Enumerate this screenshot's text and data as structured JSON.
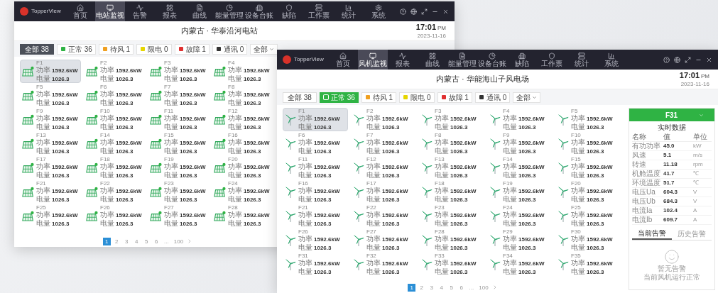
{
  "windows": [
    {
      "kind": "solar",
      "logo": "TopperView",
      "title": "内蒙古 · 华泰沿河电站",
      "clock": {
        "time": "17:01",
        "meridiem": "PM",
        "date": "2023-11-16"
      },
      "nav": [
        {
          "label": "首页",
          "selected": false
        },
        {
          "label": "电站监视",
          "selected": true
        },
        {
          "label": "告警",
          "selected": false
        },
        {
          "label": "报表",
          "selected": false
        },
        {
          "label": "曲线",
          "selected": false
        },
        {
          "label": "能量管理",
          "selected": false
        },
        {
          "label": "设备台账",
          "selected": false
        },
        {
          "label": "缺陷",
          "selected": false
        },
        {
          "label": "工作票",
          "selected": false
        },
        {
          "label": "统计",
          "selected": false
        },
        {
          "label": "系统",
          "selected": false
        }
      ],
      "filters": [
        {
          "kind": "total",
          "label": "全部",
          "count": "38",
          "selected": true
        },
        {
          "kind": "status",
          "label": "正常",
          "count": "36",
          "color": "#2fb344",
          "selected": false
        },
        {
          "kind": "status",
          "label": "待风",
          "count": "1",
          "color": "#f0a020",
          "selected": false
        },
        {
          "kind": "status",
          "label": "限电",
          "count": "0",
          "color": "#e6d600",
          "selected": false
        },
        {
          "kind": "status",
          "label": "故障",
          "count": "1",
          "color": "#e03030",
          "selected": false
        },
        {
          "kind": "status",
          "label": "通讯",
          "count": "0",
          "color": "#333333",
          "selected": false
        },
        {
          "kind": "dropdown",
          "label": "全部"
        }
      ],
      "cells": [
        {
          "name": "F1",
          "selected": true,
          "power_label": "功率",
          "power": "1592.6kW",
          "energy_label": "电量",
          "energy": "1026.3"
        },
        {
          "name": "F2",
          "selected": false,
          "power_label": "功率",
          "power": "1592.6kW",
          "energy_label": "电量",
          "energy": "1026.3"
        },
        {
          "name": "F3",
          "selected": false,
          "power_label": "功率",
          "power": "1592.6kW",
          "energy_label": "电量",
          "energy": "1026.3"
        },
        {
          "name": "F4",
          "selected": false,
          "power_label": "功率",
          "power": "1592.6kW",
          "energy_label": "电量",
          "energy": "1026.3"
        },
        {
          "name": "F5",
          "selected": false,
          "power_label": "功率",
          "power": "1592.6kW",
          "energy_label": "电量",
          "energy": "1026.3"
        },
        {
          "name": "F6",
          "selected": false,
          "power_label": "功率",
          "power": "1592.6kW",
          "energy_label": "电量",
          "energy": "1026.3"
        },
        {
          "name": "F7",
          "selected": false,
          "power_label": "功率",
          "power": "1592.6kW",
          "energy_label": "电量",
          "energy": "1026.3"
        },
        {
          "name": "F8",
          "selected": false,
          "power_label": "功率",
          "power": "1592.6kW",
          "energy_label": "电量",
          "energy": "1026.3"
        },
        {
          "name": "F9",
          "selected": false,
          "power_label": "功率",
          "power": "1592.6kW",
          "energy_label": "电量",
          "energy": "1026.3"
        },
        {
          "name": "F10",
          "selected": false,
          "power_label": "功率",
          "power": "1592.6kW",
          "energy_label": "电量",
          "energy": "1026.3"
        },
        {
          "name": "F11",
          "selected": false,
          "power_label": "功率",
          "power": "1592.6kW",
          "energy_label": "电量",
          "energy": "1026.3"
        },
        {
          "name": "F12",
          "selected": false,
          "power_label": "功率",
          "power": "1592.6kW",
          "energy_label": "电量",
          "energy": "1026.3"
        },
        {
          "name": "F13",
          "selected": false,
          "power_label": "功率",
          "power": "1592.6kW",
          "energy_label": "电量",
          "energy": "1026.3"
        },
        {
          "name": "F14",
          "selected": false,
          "power_label": "功率",
          "power": "1592.6kW",
          "energy_label": "电量",
          "energy": "1026.3"
        },
        {
          "name": "F15",
          "selected": false,
          "power_label": "功率",
          "power": "1592.6kW",
          "energy_label": "电量",
          "energy": "1026.3"
        },
        {
          "name": "F16",
          "selected": false,
          "power_label": "功率",
          "power": "1592.6kW",
          "energy_label": "电量",
          "energy": "1026.3"
        },
        {
          "name": "F17",
          "selected": false,
          "power_label": "功率",
          "power": "1592.6kW",
          "energy_label": "电量",
          "energy": "1026.3"
        },
        {
          "name": "F18",
          "selected": false,
          "power_label": "功率",
          "power": "1592.6kW",
          "energy_label": "电量",
          "energy": "1026.3"
        },
        {
          "name": "F19",
          "selected": false,
          "power_label": "功率",
          "power": "1592.6kW",
          "energy_label": "电量",
          "energy": "1026.3"
        },
        {
          "name": "F20",
          "selected": false,
          "power_label": "功率",
          "power": "1592.6kW",
          "energy_label": "电量",
          "energy": "1026.3"
        },
        {
          "name": "F21",
          "selected": false,
          "power_label": "功率",
          "power": "1592.6kW",
          "energy_label": "电量",
          "energy": "1026.3"
        },
        {
          "name": "F22",
          "selected": false,
          "power_label": "功率",
          "power": "1592.6kW",
          "energy_label": "电量",
          "energy": "1026.3"
        },
        {
          "name": "F23",
          "selected": false,
          "power_label": "功率",
          "power": "1592.6kW",
          "energy_label": "电量",
          "energy": "1026.3"
        },
        {
          "name": "F24",
          "selected": false,
          "power_label": "功率",
          "power": "1592.6kW",
          "energy_label": "电量",
          "energy": "1026.3"
        },
        {
          "name": "F25",
          "selected": false,
          "power_label": "功率",
          "power": "1592.6kW",
          "energy_label": "电量",
          "energy": "1026.3"
        },
        {
          "name": "F26",
          "selected": false,
          "power_label": "功率",
          "power": "1592.6kW",
          "energy_label": "电量",
          "energy": "1026.3"
        },
        {
          "name": "F27",
          "selected": false,
          "power_label": "功率",
          "power": "1592.6kW",
          "energy_label": "电量",
          "energy": "1026.3"
        },
        {
          "name": "F28",
          "selected": false,
          "power_label": "功率",
          "power": "1592.6kW",
          "energy_label": "电量",
          "energy": "1026.3"
        }
      ],
      "pagination": [
        {
          "label": "1",
          "selected": true
        },
        {
          "label": "2",
          "selected": false
        },
        {
          "label": "3",
          "selected": false
        },
        {
          "label": "4",
          "selected": false
        },
        {
          "label": "5",
          "selected": false
        },
        {
          "label": "6",
          "selected": false
        },
        {
          "label": "...",
          "selected": false
        },
        {
          "label": "100",
          "selected": false
        }
      ]
    },
    {
      "kind": "turbine",
      "logo": "TopperView",
      "title": "内蒙古 · 华能海山子风电场",
      "clock": {
        "time": "17:01",
        "meridiem": "PM",
        "date": "2023-11-16"
      },
      "nav": [
        {
          "label": "首页",
          "selected": false
        },
        {
          "label": "风机监视",
          "selected": true
        },
        {
          "label": "报表",
          "selected": false
        },
        {
          "label": "曲线",
          "selected": false
        },
        {
          "label": "能量管理",
          "selected": false
        },
        {
          "label": "设备台账",
          "selected": false
        },
        {
          "label": "缺陷",
          "selected": false
        },
        {
          "label": "工作票",
          "selected": false
        },
        {
          "label": "统计",
          "selected": false
        },
        {
          "label": "系统",
          "selected": false
        }
      ],
      "filters": [
        {
          "kind": "total",
          "label": "全部",
          "count": "38",
          "selected": false
        },
        {
          "kind": "status",
          "label": "正常",
          "count": "36",
          "color": "#2fb344",
          "selected": true
        },
        {
          "kind": "status",
          "label": "待风",
          "count": "1",
          "color": "#f0a020",
          "selected": false
        },
        {
          "kind": "status",
          "label": "限电",
          "count": "0",
          "color": "#e6d600",
          "selected": false
        },
        {
          "kind": "status",
          "label": "故障",
          "count": "1",
          "color": "#e03030",
          "selected": false
        },
        {
          "kind": "status",
          "label": "通讯",
          "count": "0",
          "color": "#333333",
          "selected": false
        },
        {
          "kind": "dropdown",
          "label": "全部"
        }
      ],
      "cells": [
        {
          "name": "F1",
          "selected": true,
          "power_label": "功率",
          "power": "1592.6kW",
          "energy_label": "电量",
          "energy": "1026.3"
        },
        {
          "name": "F2",
          "selected": false,
          "power_label": "功率",
          "power": "1592.6kW",
          "energy_label": "电量",
          "energy": "1026.3"
        },
        {
          "name": "F3",
          "selected": false,
          "power_label": "功率",
          "power": "1592.6kW",
          "energy_label": "电量",
          "energy": "1026.3"
        },
        {
          "name": "F4",
          "selected": false,
          "power_label": "功率",
          "power": "1592.6kW",
          "energy_label": "电量",
          "energy": "1026.3"
        },
        {
          "name": "F5",
          "selected": false,
          "power_label": "功率",
          "power": "1592.6kW",
          "energy_label": "电量",
          "energy": "1026.3"
        },
        {
          "name": "F6",
          "selected": false,
          "power_label": "功率",
          "power": "1592.6kW",
          "energy_label": "电量",
          "energy": "1026.3"
        },
        {
          "name": "F7",
          "selected": false,
          "power_label": "功率",
          "power": "1592.6kW",
          "energy_label": "电量",
          "energy": "1026.3"
        },
        {
          "name": "F8",
          "selected": false,
          "power_label": "功率",
          "power": "1592.6kW",
          "energy_label": "电量",
          "energy": "1026.3"
        },
        {
          "name": "F9",
          "selected": false,
          "power_label": "功率",
          "power": "1592.6kW",
          "energy_label": "电量",
          "energy": "1026.3"
        },
        {
          "name": "F10",
          "selected": false,
          "power_label": "功率",
          "power": "1592.6kW",
          "energy_label": "电量",
          "energy": "1026.3"
        },
        {
          "name": "F11",
          "selected": false,
          "power_label": "功率",
          "power": "1592.6kW",
          "energy_label": "电量",
          "energy": "1026.3"
        },
        {
          "name": "F12",
          "selected": false,
          "power_label": "功率",
          "power": "1592.6kW",
          "energy_label": "电量",
          "energy": "1026.3"
        },
        {
          "name": "F13",
          "selected": false,
          "power_label": "功率",
          "power": "1592.6kW",
          "energy_label": "电量",
          "energy": "1026.3"
        },
        {
          "name": "F14",
          "selected": false,
          "power_label": "功率",
          "power": "1592.6kW",
          "energy_label": "电量",
          "energy": "1026.3"
        },
        {
          "name": "F15",
          "selected": false,
          "power_label": "功率",
          "power": "1592.6kW",
          "energy_label": "电量",
          "energy": "1026.3"
        },
        {
          "name": "F16",
          "selected": false,
          "power_label": "功率",
          "power": "1592.6kW",
          "energy_label": "电量",
          "energy": "1026.3"
        },
        {
          "name": "F17",
          "selected": false,
          "power_label": "功率",
          "power": "1592.6kW",
          "energy_label": "电量",
          "energy": "1026.3"
        },
        {
          "name": "F18",
          "selected": false,
          "power_label": "功率",
          "power": "1592.6kW",
          "energy_label": "电量",
          "energy": "1026.3"
        },
        {
          "name": "F19",
          "selected": false,
          "power_label": "功率",
          "power": "1592.6kW",
          "energy_label": "电量",
          "energy": "1026.3"
        },
        {
          "name": "F20",
          "selected": false,
          "power_label": "功率",
          "power": "1592.6kW",
          "energy_label": "电量",
          "energy": "1026.3"
        },
        {
          "name": "F21",
          "selected": false,
          "power_label": "功率",
          "power": "1592.6kW",
          "energy_label": "电量",
          "energy": "1026.3"
        },
        {
          "name": "F22",
          "selected": false,
          "power_label": "功率",
          "power": "1592.6kW",
          "energy_label": "电量",
          "energy": "1026.3"
        },
        {
          "name": "F23",
          "selected": false,
          "power_label": "功率",
          "power": "1592.6kW",
          "energy_label": "电量",
          "energy": "1026.3"
        },
        {
          "name": "F24",
          "selected": false,
          "power_label": "功率",
          "power": "1592.6kW",
          "energy_label": "电量",
          "energy": "1026.3"
        },
        {
          "name": "F25",
          "selected": false,
          "power_label": "功率",
          "power": "1592.6kW",
          "energy_label": "电量",
          "energy": "1026.3"
        },
        {
          "name": "F26",
          "selected": false,
          "power_label": "功率",
          "power": "1592.6kW",
          "energy_label": "电量",
          "energy": "1026.3"
        },
        {
          "name": "F27",
          "selected": false,
          "power_label": "功率",
          "power": "1592.6kW",
          "energy_label": "电量",
          "energy": "1026.3"
        },
        {
          "name": "F28",
          "selected": false,
          "power_label": "功率",
          "power": "1592.6kW",
          "energy_label": "电量",
          "energy": "1026.3"
        },
        {
          "name": "F29",
          "selected": false,
          "power_label": "功率",
          "power": "1592.6kW",
          "energy_label": "电量",
          "energy": "1026.3"
        },
        {
          "name": "F30",
          "selected": false,
          "power_label": "功率",
          "power": "1592.6kW",
          "energy_label": "电量",
          "energy": "1026.3"
        },
        {
          "name": "F31",
          "selected": false,
          "power_label": "功率",
          "power": "1592.6kW",
          "energy_label": "电量",
          "energy": "1026.3"
        },
        {
          "name": "F32",
          "selected": false,
          "power_label": "功率",
          "power": "1592.6kW",
          "energy_label": "电量",
          "energy": "1026.3"
        },
        {
          "name": "F33",
          "selected": false,
          "power_label": "功率",
          "power": "1592.6kW",
          "energy_label": "电量",
          "energy": "1026.3"
        },
        {
          "name": "F34",
          "selected": false,
          "power_label": "功率",
          "power": "1592.6kW",
          "energy_label": "电量",
          "energy": "1026.3"
        },
        {
          "name": "F35",
          "selected": false,
          "power_label": "功率",
          "power": "1592.6kW",
          "energy_label": "电量",
          "energy": "1026.3"
        }
      ],
      "pagination": [
        {
          "label": "1",
          "selected": true
        },
        {
          "label": "2",
          "selected": false
        },
        {
          "label": "3",
          "selected": false
        },
        {
          "label": "4",
          "selected": false
        },
        {
          "label": "5",
          "selected": false
        },
        {
          "label": "6",
          "selected": false
        },
        {
          "label": "...",
          "selected": false
        },
        {
          "label": "100",
          "selected": false
        }
      ],
      "panel": {
        "device": "F31",
        "title": "实时数据",
        "columns": [
          "名称",
          "值",
          "单位"
        ],
        "rows": [
          [
            "有功功率",
            "45.0",
            "kW"
          ],
          [
            "风速",
            "5.1",
            "m/s"
          ],
          [
            "转速",
            "11.18",
            "rpm"
          ],
          [
            "机舱温度",
            "41.7",
            "℃"
          ],
          [
            "环境温度",
            "51.7",
            "℃"
          ],
          [
            "电压Ua",
            "604.3",
            "V"
          ],
          [
            "电压Ub",
            "684.3",
            "V"
          ],
          [
            "电流Ia",
            "102.4",
            "A"
          ],
          [
            "电流Ib",
            "609.7",
            "A"
          ]
        ],
        "tabs": [
          {
            "label": "当前告警",
            "selected": true
          },
          {
            "label": "历史告警",
            "selected": false
          }
        ],
        "empty": {
          "title": "暂无告警",
          "subtitle": "当前风机运行正常"
        }
      }
    }
  ]
}
